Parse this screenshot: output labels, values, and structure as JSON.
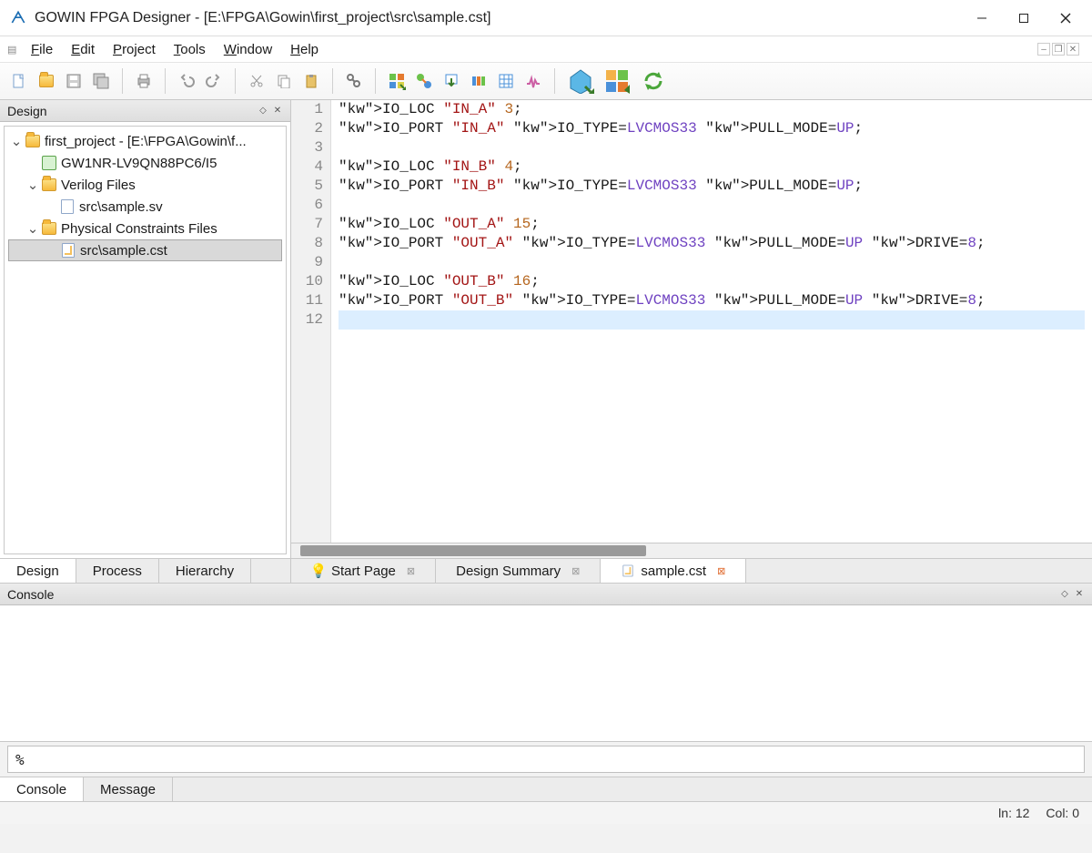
{
  "window": {
    "title": "GOWIN FPGA Designer - [E:\\FPGA\\Gowin\\first_project\\src\\sample.cst]"
  },
  "menu": {
    "file": "File",
    "edit": "Edit",
    "project": "Project",
    "tools": "Tools",
    "window": "Window",
    "help": "Help"
  },
  "design_panel": {
    "title": "Design",
    "tree": {
      "project": "first_project - [E:\\FPGA\\Gowin\\f...",
      "device": "GW1NR-LV9QN88PC6/I5",
      "verilog_group": "Verilog Files",
      "verilog_file": "src\\sample.sv",
      "constraints_group": "Physical Constraints Files",
      "constraints_file": "src\\sample.cst"
    },
    "tabs": {
      "design": "Design",
      "process": "Process",
      "hierarchy": "Hierarchy"
    }
  },
  "editor": {
    "lines": [
      "IO_LOC \"IN_A\" 3;",
      "IO_PORT \"IN_A\" IO_TYPE=LVCMOS33 PULL_MODE=UP;",
      "",
      "IO_LOC \"IN_B\" 4;",
      "IO_PORT \"IN_B\" IO_TYPE=LVCMOS33 PULL_MODE=UP;",
      "",
      "IO_LOC \"OUT_A\" 15;",
      "IO_PORT \"OUT_A\" IO_TYPE=LVCMOS33 PULL_MODE=UP DRIVE=8;",
      "",
      "IO_LOC \"OUT_B\" 16;",
      "IO_PORT \"OUT_B\" IO_TYPE=LVCMOS33 PULL_MODE=UP DRIVE=8;",
      ""
    ],
    "tabs": {
      "start": "Start Page",
      "summary": "Design Summary",
      "cst": "sample.cst"
    }
  },
  "console": {
    "title": "Console",
    "prompt": "%",
    "tabs": {
      "console": "Console",
      "message": "Message"
    }
  },
  "status": {
    "line": "ln: 12",
    "col": "Col: 0"
  }
}
